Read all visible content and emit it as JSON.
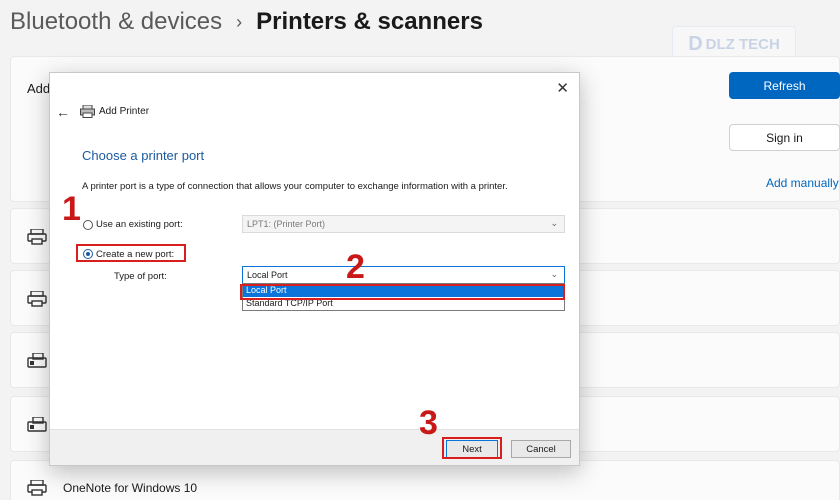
{
  "breadcrumb": {
    "parent": "Bluetooth & devices",
    "separator": "›",
    "current": "Printers & scanners"
  },
  "watermark": {
    "text": "DLZ TECH",
    "logo_letter": "D"
  },
  "settings": {
    "add_row_label": "Add",
    "refresh_label": "Refresh",
    "signin_label": "Sign in",
    "add_manually_label": "Add manually",
    "printers": [
      "",
      "",
      "",
      "",
      "OneNote for Windows 10"
    ]
  },
  "dialog": {
    "title": "Add Printer",
    "close_glyph": "✕",
    "back_glyph": "←",
    "heading": "Choose a printer port",
    "description": "A printer port is a type of connection that allows your computer to exchange information with a printer.",
    "existing_port_label": "Use an existing port:",
    "existing_port_value": "LPT1: (Printer Port)",
    "new_port_label": "Create a new port:",
    "type_of_port_label": "Type of port:",
    "type_of_port_value": "Local Port",
    "port_options": [
      "Local Port",
      "Standard TCP/IP Port"
    ],
    "selected_option_index": 0,
    "next_label": "Next",
    "cancel_label": "Cancel"
  },
  "annotations": {
    "step1": "1",
    "step2": "2",
    "step3": "3"
  },
  "colors": {
    "accent": "#0067c0",
    "annotation_red": "#d81e1e",
    "heading_blue": "#1a5a9f"
  }
}
